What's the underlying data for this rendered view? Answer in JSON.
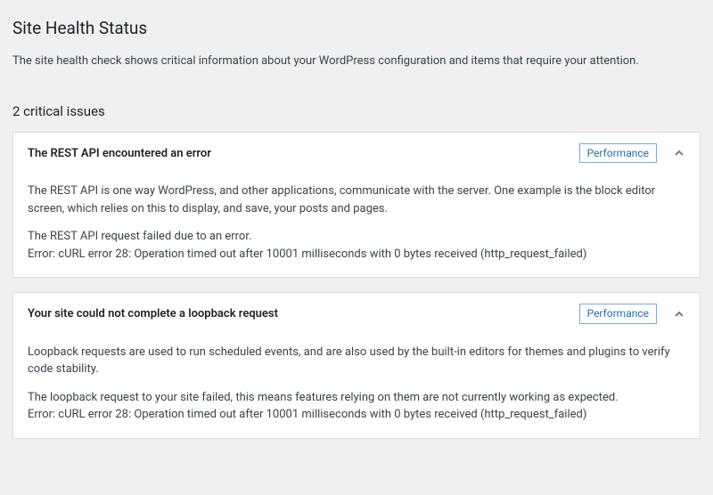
{
  "page": {
    "title": "Site Health Status",
    "intro": "The site health check shows critical information about your WordPress configuration and items that require your attention."
  },
  "issues": {
    "heading": "2 critical issues",
    "list": [
      {
        "title": "The REST API encountered an error",
        "badge": "Performance",
        "para1": "The REST API is one way WordPress, and other applications, communicate with the server. One example is the block editor screen, which relies on this to display, and save, your posts and pages.",
        "para2_line1": "The REST API request failed due to an error.",
        "para2_line2": "Error: cURL error 28: Operation timed out after 10001 milliseconds with 0 bytes received (http_request_failed)"
      },
      {
        "title": "Your site could not complete a loopback request",
        "badge": "Performance",
        "para1": "Loopback requests are used to run scheduled events, and are also used by the built-in editors for themes and plugins to verify code stability.",
        "para2_line1": "The loopback request to your site failed, this means features relying on them are not currently working as expected.",
        "para2_line2": "Error: cURL error 28: Operation timed out after 10001 milliseconds with 0 bytes received (http_request_failed)"
      }
    ]
  }
}
